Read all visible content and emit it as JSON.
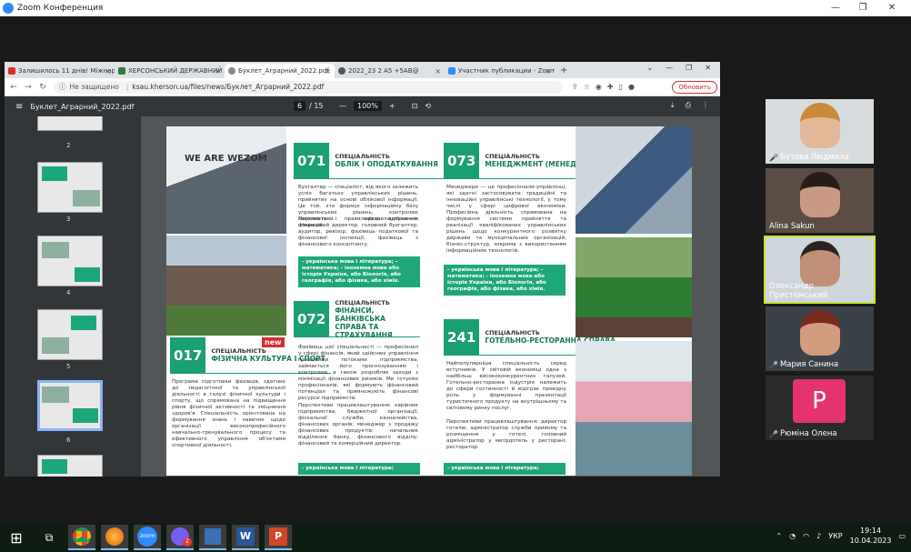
{
  "zoom": {
    "title": "Zoom Конференция",
    "controls": [
      "—",
      "❐",
      "✕"
    ]
  },
  "tabs": [
    {
      "label": "Залишилось 11 днів! Міжнарод",
      "color": "#d93025"
    },
    {
      "label": "ХЕРСОНСЬКИЙ ДЕРЖАВНИЙ А",
      "color": "#2e7d32"
    },
    {
      "label": "Буклет_Аграрний_2022.pdf",
      "color": "#888"
    },
    {
      "label": "2022_23 2 А5 +5АВ@",
      "color": "#555"
    },
    {
      "label": "Участник публикации - Zoom",
      "color": "#2d8cff"
    }
  ],
  "address": {
    "warning": "Не защищено",
    "url": "ksau.kherson.ua/files/news/Буклет_Аграрний_2022.pdf",
    "update": "Обновить"
  },
  "pdf": {
    "filename": "Буклет_Аграрний_2022.pdf",
    "page": "6",
    "total": "/ 15",
    "zoom": "100%"
  },
  "thumbs": [
    "2",
    "3",
    "4",
    "5",
    "6"
  ],
  "booklet": {
    "wezom": "WE ARE WEZOM",
    "new": "new",
    "s071": {
      "num": "071",
      "k": "СПЕЦІАЛЬНІСТЬ",
      "t": "ОБЛІК І ОПОДАТКУВАННЯ",
      "p1": "Бухгалтер — спеціаліст, від якого залежить успіх багатьох управлінських рішень, прийнятих на основі облікової інформації. Це той, хто формує інформаційну базу управлінських рішень, контролює законність і правильність здійснення операцій.",
      "p2": "Перспективи працевлаштування: фінансовий директор, головний бухгалтер, аудитор, ревізор, фахівець податкової та фінансової інспекції, фахівець з фінансового консалтингу.",
      "box": "- українська мова і література; - математика; - іноземна мова або історія України, або Біологія, або географія, або фізика, або хімія."
    },
    "s072": {
      "num": "072",
      "k": "СПЕЦІАЛЬНІСТЬ",
      "t": "ФІНАНСИ, БАНКІВСЬКА СПРАВА ТА СТРАХУВАННЯ",
      "p1": "Фахівець цієї спеціальності — професіонал у сфері фінансів, який здійснює управління грошовими потоками підприємства, займається його прогнозуванням і контролем, а також розробляє заходи з мінімізації фінансових ризиків. Ми готуємо професіоналів, які формують фінансовий потенціал та примножують фінансові ресурси підприємств.",
      "p2": "Перспективи працевлаштування: керівник підприємства, бюджетної організації, фіскальної служби, казначейства, фінансових органів; менеджер з продажу фінансових продуктів; начальник відділення банку, фінансового відділу; фінансовий та комерційний директор.",
      "box": "- українська мова і література;"
    },
    "s017": {
      "num": "017",
      "k": "СПЕЦІАЛЬНІСТЬ",
      "t": "ФІЗИЧНА КУЛЬТУРА І СПОРТ",
      "p1": "Програма підготовки фахівців, здатних до педагогічної та управлінської діяльності в галузі фізичної культури і спорту, що спрямована на підвищення рівня фізичної активності та зміцнення здоров'я. Спеціальність орієнтована на формування знань і навичок щодо організації високопрофесійного навчально-тренувального процесу та ефективного управління об'єктами спортивної діяльності."
    },
    "s073": {
      "num": "073",
      "k": "СПЕЦІАЛЬНІСТЬ",
      "t": "МЕНЕДЖМЕНТ (МЕНЕДЖМЕНТ ІТ)",
      "p1": "Менеджери — це професіонали-управлінці, які здатні застосовувати традиційні та інноваційні управлінські технології, у тому числі у сфері цифрової економіки. Професійна діяльність спрямована на формування системи прийняття та реалізації кваліфікованих управлінських рішень щодо конкурентного розвитку держави та муніципальних організацій, бізнес-структур, зокрема з використанням інформаційних технологій.",
      "box": "- українська мова і література; - математика; - іноземна мова або історія України, або Біологія, або географія, або фізика, або хімія."
    },
    "s241": {
      "num": "241",
      "k": "СПЕЦІАЛЬНІСТЬ",
      "t": "ГОТЕЛЬНО-РЕСТОРАННА СПРАВА",
      "p1": "Найпопулярніша спеціальність серед вступників. У світовій економіці одна з найбільш висококонкурентних галузей. Готельно-ресторанна індустрія належить до сфери гостинності й відіграє провідну роль у формуванні презентації туристичного продукту на внутрішньому та світовому ринку послуг.",
      "p2": "Перспективи працевлаштування: директор готелю, адміністратор служби прийому та розміщення у готелі, головний адміністратор у метрдотель у ресторані, ресторатор.",
      "box": "- українська мова і література;"
    }
  },
  "participants": [
    {
      "name": "Бутова Людмила",
      "bg": "#d9dcdf",
      "face": "#e2b898",
      "hair": "#c98a3a"
    },
    {
      "name": "Alina Sakun",
      "bg": "#5b4c44",
      "face": "#c99a82",
      "hair": "#2a1d18"
    },
    {
      "name": "Олександр Пристемський",
      "bg": "#cfd6dc",
      "face": "#c08f76",
      "hair": "#2b2320"
    },
    {
      "name": "Мария Санина",
      "bg": "#3a4148",
      "face": "#d29c7e",
      "hair": "#7b2a20"
    },
    {
      "name": "Рюміна Олена",
      "bg": "#2a2a2a",
      "initial": "P",
      "avatar": "#e5336f"
    }
  ],
  "taskbar": {
    "lang": "УКР",
    "time": "19:14",
    "date": "10.04.2023",
    "zoom": "zoom",
    "badge": "2"
  }
}
